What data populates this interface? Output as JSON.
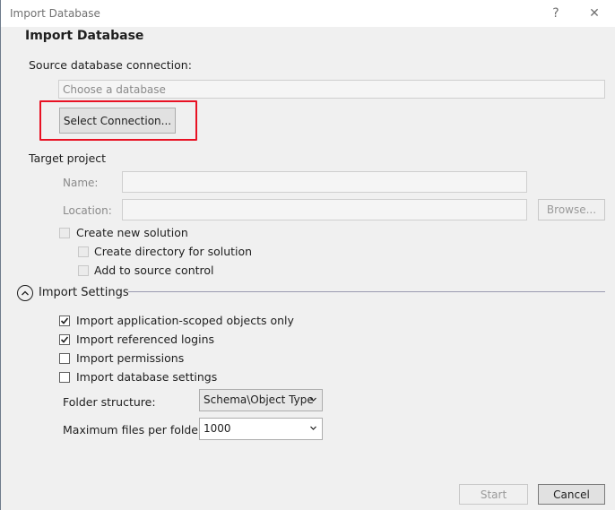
{
  "window": {
    "title": "Import Database",
    "help_glyph": "?",
    "close_glyph": "✕"
  },
  "heading": "Import Database",
  "source": {
    "label": "Source database connection:",
    "placeholder": "Choose a database",
    "select_button": "Select Connection..."
  },
  "target": {
    "label": "Target project",
    "name_label": "Name:",
    "name_value": "",
    "location_label": "Location:",
    "location_value": "",
    "browse_button": "Browse...",
    "create_new_solution": {
      "label": "Create new solution",
      "checked": false,
      "enabled": false
    },
    "create_directory": {
      "label": "Create directory for solution",
      "checked": false,
      "enabled": false
    },
    "add_source_control": {
      "label": "Add to source control",
      "checked": false,
      "enabled": false
    }
  },
  "settings": {
    "label": "Import Settings",
    "options": [
      {
        "label": "Import application-scoped objects only",
        "checked": true
      },
      {
        "label": "Import referenced logins",
        "checked": true
      },
      {
        "label": "Import permissions",
        "checked": false
      },
      {
        "label": "Import database settings",
        "checked": false
      }
    ],
    "folder_structure_label": "Folder structure:",
    "folder_structure_value": "Schema\\Object Type",
    "max_files_label": "Maximum files per folder:",
    "max_files_value": "1000"
  },
  "footer": {
    "start_button": "Start",
    "cancel_button": "Cancel"
  },
  "colors": {
    "highlight": "#e81123",
    "background": "#f0f0f0"
  }
}
